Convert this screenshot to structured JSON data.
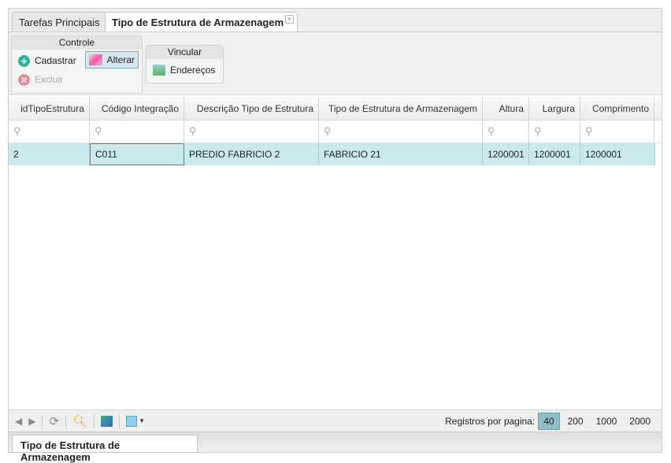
{
  "tabs": [
    {
      "label": "Tarefas Principais"
    },
    {
      "label": "Tipo de Estrutura de Armazenagem",
      "close": "×"
    }
  ],
  "ribbon": {
    "controle": {
      "title": "Controle",
      "cadastrar": "Cadastrar",
      "alterar": "Alterar",
      "excluir": "Excluir"
    },
    "vincular": {
      "title": "Vincular",
      "enderecos": "Endereços"
    }
  },
  "grid": {
    "columns": [
      "idTipoEstrutura",
      "Código Integração",
      "Descrição Tipo de Estrutura",
      "Tipo de Estrutura de Armazenagem",
      "Altura",
      "Largura",
      "Comprimento"
    ],
    "rows": [
      [
        "2",
        "C011",
        "PREDIO FABRICIO 2",
        "FABRICIO 21",
        "1200001",
        "1200001",
        "1200001"
      ]
    ]
  },
  "pager": {
    "label": "Registros por pagina:",
    "sizes": [
      "40",
      "200",
      "1000",
      "2000"
    ],
    "selected": "40"
  },
  "bottom_tab": "Tipo de Estrutura de Armazenagem"
}
